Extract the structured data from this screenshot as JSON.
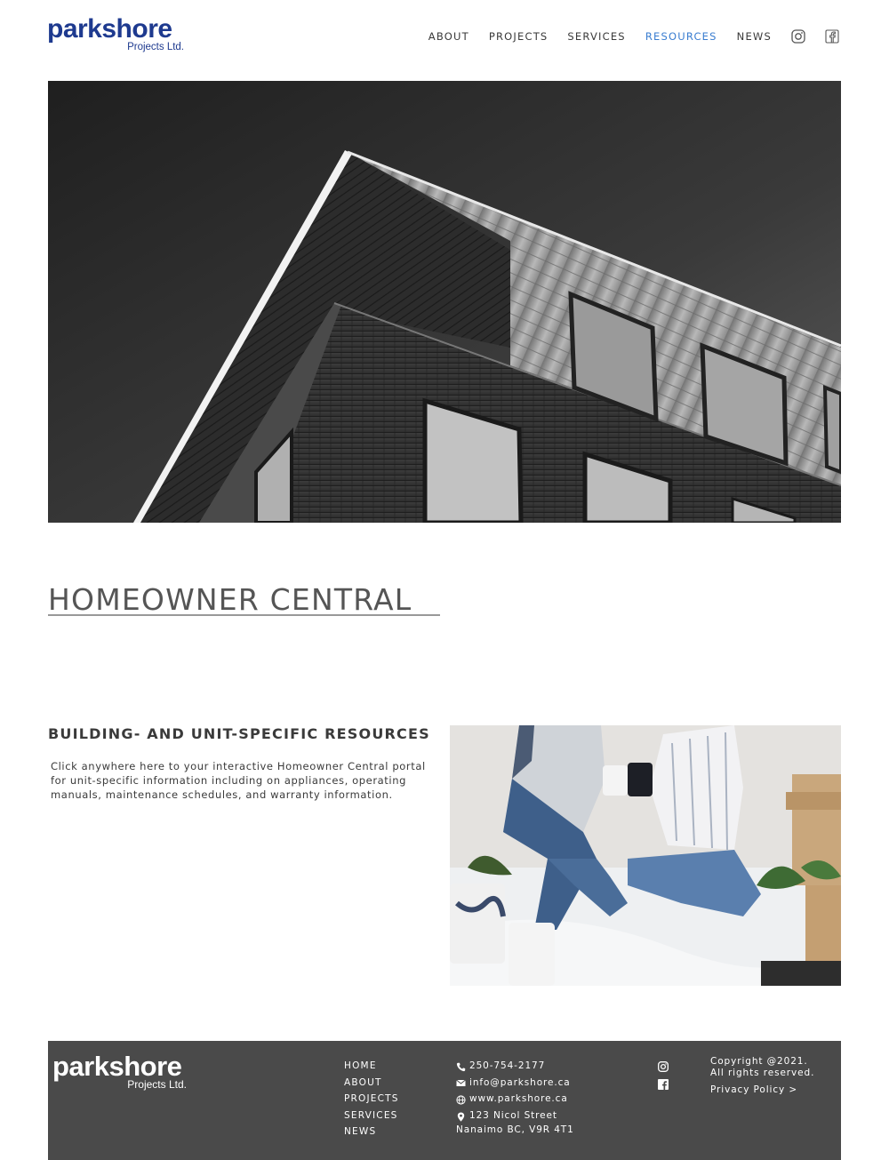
{
  "header": {
    "logo_main": "parkshore",
    "logo_sub": "Projects Ltd.",
    "nav": [
      "ABOUT",
      "PROJECTS",
      "SERVICES",
      "RESOURCES",
      "NEWS"
    ],
    "active_nav": "RESOURCES",
    "social_icons": [
      "instagram-icon",
      "facebook-icon"
    ]
  },
  "colors": {
    "brand_blue": "#1e3a8f",
    "active_link": "#3a7dd0",
    "footer_bg": "#4a4a4a",
    "title_gray": "#555555"
  },
  "main": {
    "page_title": "HOMEOWNER CENTRAL",
    "section_heading": "BUILDING- AND UNIT-SPECIFIC RESOURCES",
    "section_body": "Click anywhere here to your interactive Homeowner Central portal for unit-specific information including on appliances, operating manuals, maintenance schedules, and warranty information."
  },
  "footer": {
    "logo_main": "parkshore",
    "logo_sub": "Projects Ltd.",
    "nav": [
      "HOME",
      "ABOUT",
      "PROJECTS",
      "SERVICES",
      "NEWS"
    ],
    "phone": "250-754-2177",
    "email": "info@parkshore.ca",
    "website": "www.parkshore.ca",
    "address_line1": "123 Nicol Street",
    "address_line2": "Nanaimo BC, V9R 4T1",
    "copyright_line1": "Copyright @2021.",
    "copyright_line2": "All rights reserved.",
    "privacy_link": "Privacy Policy >"
  }
}
